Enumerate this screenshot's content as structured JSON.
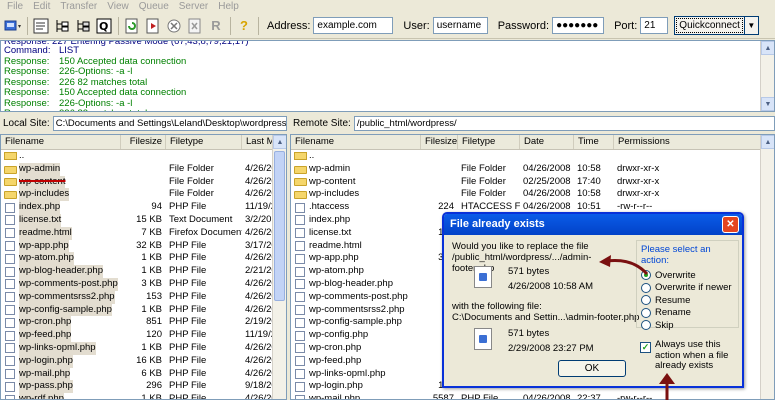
{
  "menu": [
    "File",
    "Edit",
    "Transfer",
    "View",
    "Queue",
    "Server",
    "Help"
  ],
  "connect": {
    "address_label": "Address:",
    "address_value": "example.com",
    "user_label": "User:",
    "user_value": "username",
    "password_label": "Password:",
    "password_value": "●●●●●●●",
    "port_label": "Port:",
    "port_value": "21",
    "quickconnect_label": "Quickconnect"
  },
  "log": [
    {
      "type": "cmd",
      "key": "Command:",
      "value": "LIST"
    },
    {
      "type": "resp",
      "key": "Response:",
      "value": "150 Accepted data connection"
    },
    {
      "type": "resp",
      "key": "Response:",
      "value": "226-Options: -a -l"
    },
    {
      "type": "resp",
      "key": "Response:",
      "value": "226 82 matches total"
    },
    {
      "type": "resp",
      "key": "Response:",
      "value": "150 Accepted data connection"
    },
    {
      "type": "resp",
      "key": "Response:",
      "value": "226-Options: -a -l"
    },
    {
      "type": "resp",
      "key": "Response:",
      "value": "226 82 matches total"
    }
  ],
  "local": {
    "site_label": "Local Site:",
    "site_path": "C:\\Documents and Settings\\Leland\\Desktop\\wordpress-2.5.1",
    "headers": [
      "Filename",
      "Filesize",
      "Filetype",
      "Last M"
    ],
    "files": [
      {
        "name": "..",
        "size": "",
        "type": "",
        "date": "",
        "icon": "up",
        "hl": false,
        "strike": false
      },
      {
        "name": "wp-admin",
        "size": "",
        "type": "File Folder",
        "date": "4/26/20",
        "icon": "folder",
        "hl": true,
        "strike": false
      },
      {
        "name": "wp-content",
        "size": "",
        "type": "File Folder",
        "date": "4/26/20",
        "icon": "folder",
        "hl": true,
        "strike": true
      },
      {
        "name": "wp-includes",
        "size": "",
        "type": "File Folder",
        "date": "4/26/20",
        "icon": "folder",
        "hl": true,
        "strike": false
      },
      {
        "name": "index.php",
        "size": "94",
        "type": "PHP File",
        "date": "11/19/2",
        "icon": "file",
        "hl": true,
        "strike": false
      },
      {
        "name": "license.txt",
        "size": "15 KB",
        "type": "Text Document",
        "date": "3/2/20",
        "icon": "file",
        "hl": true,
        "strike": false
      },
      {
        "name": "readme.html",
        "size": "7 KB",
        "type": "Firefox Document",
        "date": "4/26/20",
        "icon": "file",
        "hl": true,
        "strike": false
      },
      {
        "name": "wp-app.php",
        "size": "32 KB",
        "type": "PHP File",
        "date": "3/17/20",
        "icon": "file",
        "hl": true,
        "strike": false
      },
      {
        "name": "wp-atom.php",
        "size": "1 KB",
        "type": "PHP File",
        "date": "4/26/20",
        "icon": "file",
        "hl": true,
        "strike": false
      },
      {
        "name": "wp-blog-header.php",
        "size": "1 KB",
        "type": "PHP File",
        "date": "2/21/20",
        "icon": "file",
        "hl": true,
        "strike": false
      },
      {
        "name": "wp-comments-post.php",
        "size": "3 KB",
        "type": "PHP File",
        "date": "4/26/20",
        "icon": "file",
        "hl": true,
        "strike": false
      },
      {
        "name": "wp-commentsrss2.php",
        "size": "153",
        "type": "PHP File",
        "date": "4/26/20",
        "icon": "file",
        "hl": true,
        "strike": false
      },
      {
        "name": "wp-config-sample.php",
        "size": "1 KB",
        "type": "PHP File",
        "date": "4/26/20",
        "icon": "file",
        "hl": true,
        "strike": false
      },
      {
        "name": "wp-cron.php",
        "size": "851",
        "type": "PHP File",
        "date": "2/19/20",
        "icon": "file",
        "hl": true,
        "strike": false
      },
      {
        "name": "wp-feed.php",
        "size": "120",
        "type": "PHP File",
        "date": "11/19/2",
        "icon": "file",
        "hl": true,
        "strike": false
      },
      {
        "name": "wp-links-opml.php",
        "size": "1 KB",
        "type": "PHP File",
        "date": "4/26/20",
        "icon": "file",
        "hl": true,
        "strike": false
      },
      {
        "name": "wp-login.php",
        "size": "16 KB",
        "type": "PHP File",
        "date": "4/26/20",
        "icon": "file",
        "hl": true,
        "strike": false
      },
      {
        "name": "wp-mail.php",
        "size": "6 KB",
        "type": "PHP File",
        "date": "4/26/20",
        "icon": "file",
        "hl": true,
        "strike": false
      },
      {
        "name": "wp-pass.php",
        "size": "296",
        "type": "PHP File",
        "date": "9/18/20",
        "icon": "file",
        "hl": true,
        "strike": false
      },
      {
        "name": "wp-rdf.php",
        "size": "1 KB",
        "type": "PHP File",
        "date": "4/26/20",
        "icon": "file",
        "hl": true,
        "strike": false
      }
    ]
  },
  "remote": {
    "site_label": "Remote Site:",
    "site_path": "/public_html/wordpress/",
    "headers": [
      "Filename",
      "Filesize",
      "Filetype",
      "Date",
      "Time",
      "Permissions"
    ],
    "files": [
      {
        "name": "..",
        "size": "",
        "type": "",
        "date": "",
        "time": "",
        "perm": "",
        "icon": "up"
      },
      {
        "name": "wp-admin",
        "size": "",
        "type": "File Folder",
        "date": "04/26/2008",
        "time": "10:58",
        "perm": "drwxr-xr-x",
        "icon": "folder"
      },
      {
        "name": "wp-content",
        "size": "",
        "type": "File Folder",
        "date": "02/25/2008",
        "time": "17:40",
        "perm": "drwxr-xr-x",
        "icon": "folder"
      },
      {
        "name": "wp-includes",
        "size": "",
        "type": "File Folder",
        "date": "04/26/2008",
        "time": "10:58",
        "perm": "drwxr-xr-x",
        "icon": "folder"
      },
      {
        "name": ".htaccess",
        "size": "224",
        "type": "HTACCESS File",
        "date": "04/26/2008",
        "time": "10:51",
        "perm": "-rw-r--r--",
        "icon": "file"
      },
      {
        "name": "index.php",
        "size": "",
        "type": "",
        "date": "",
        "time": "",
        "perm": "",
        "icon": "file"
      },
      {
        "name": "license.txt",
        "size": "151",
        "type": "",
        "date": "",
        "time": "",
        "perm": "",
        "icon": "file"
      },
      {
        "name": "readme.html",
        "size": "76",
        "type": "",
        "date": "",
        "time": "",
        "perm": "",
        "icon": "file"
      },
      {
        "name": "wp-app.php",
        "size": "327",
        "type": "",
        "date": "",
        "time": "",
        "perm": "",
        "icon": "file"
      },
      {
        "name": "wp-atom.php",
        "size": "",
        "type": "",
        "date": "",
        "time": "",
        "perm": "",
        "icon": "file"
      },
      {
        "name": "wp-blog-header.php",
        "size": "",
        "type": "",
        "date": "",
        "time": "",
        "perm": "",
        "icon": "file"
      },
      {
        "name": "wp-comments-post.php",
        "size": "",
        "type": "",
        "date": "",
        "time": "",
        "perm": "",
        "icon": "file"
      },
      {
        "name": "wp-commentsrss2.php",
        "size": "",
        "type": "",
        "date": "",
        "time": "",
        "perm": "",
        "icon": "file"
      },
      {
        "name": "wp-config-sample.php",
        "size": "",
        "type": "",
        "date": "",
        "time": "",
        "perm": "",
        "icon": "file"
      },
      {
        "name": "wp-config.php",
        "size": "",
        "type": "",
        "date": "",
        "time": "",
        "perm": "",
        "icon": "file"
      },
      {
        "name": "wp-cron.php",
        "size": "",
        "type": "",
        "date": "",
        "time": "",
        "perm": "",
        "icon": "file"
      },
      {
        "name": "wp-feed.php",
        "size": "",
        "type": "",
        "date": "",
        "time": "",
        "perm": "",
        "icon": "file"
      },
      {
        "name": "wp-links-opml.php",
        "size": "",
        "type": "",
        "date": "",
        "time": "",
        "perm": "",
        "icon": "file"
      },
      {
        "name": "wp-login.php",
        "size": "164",
        "type": "",
        "date": "",
        "time": "",
        "perm": "",
        "icon": "file"
      },
      {
        "name": "wp-mail.php",
        "size": "5587",
        "type": "PHP File",
        "date": "04/26/2008",
        "time": "22:37",
        "perm": "-rw-r--r--",
        "icon": "file"
      }
    ]
  },
  "dialog": {
    "title": "File already exists",
    "question": "Would you like to replace the file /public_html/wordpress/.../admin-footer.php",
    "existing_size": "571 bytes",
    "existing_date": "4/26/2008 10:58 AM",
    "with_label": "with the following file:",
    "new_path": "C:\\Documents and Settin...\\admin-footer.php",
    "new_size": "571 bytes",
    "new_date": "2/29/2008 23:27 PM",
    "actions_title": "Please select an action:",
    "actions": [
      "Overwrite",
      "Overwrite if newer",
      "Resume",
      "Rename",
      "Skip"
    ],
    "selected_action": "Overwrite",
    "always_label": "Always use this action when a file already exists",
    "always_checked": true,
    "ok_label": "OK"
  },
  "colors": {
    "command": "#000080",
    "response": "#008000",
    "dialog_title": "#0831d9",
    "annotation_arrow": "#7a1010"
  },
  "toolbar_icons": [
    "site-manager-icon",
    "toggle-log-icon",
    "toggle-local-tree-icon",
    "toggle-remote-tree-icon",
    "toggle-queue-icon",
    "refresh-icon",
    "process-queue-icon",
    "cancel-icon",
    "disconnect-icon",
    "reconnect-icon",
    "help-icon"
  ]
}
